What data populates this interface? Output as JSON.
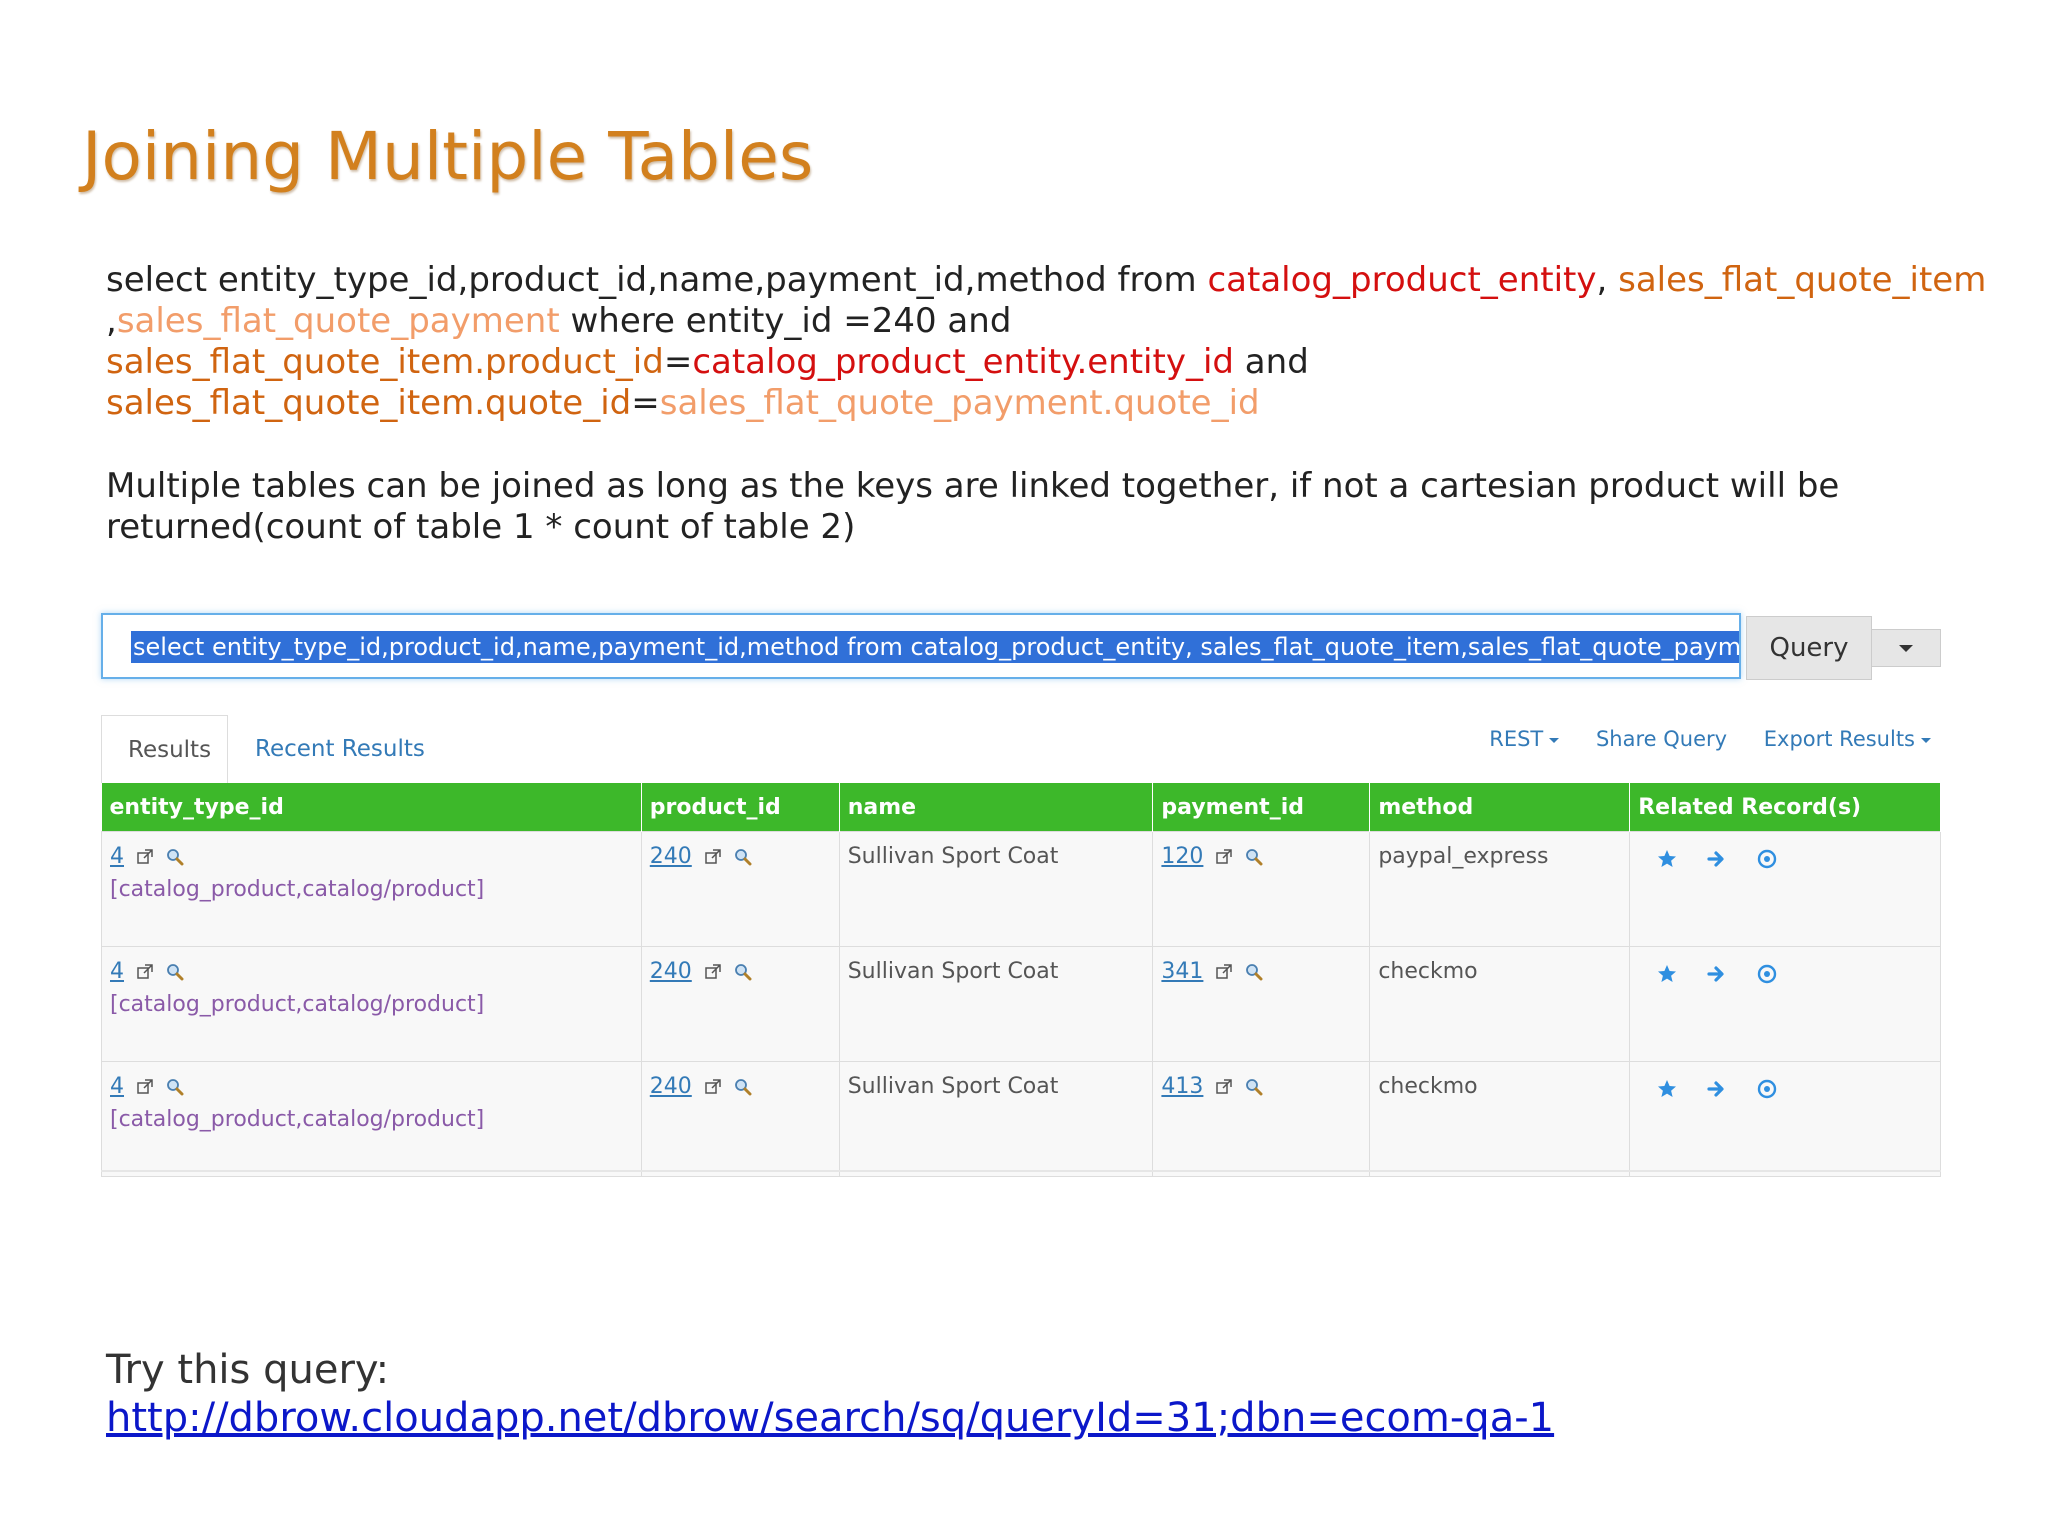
{
  "title": "Joining Multiple Tables",
  "sql": {
    "p1": "select entity_type_id,product_id,name,payment_id,method from ",
    "t1": "catalog_product_entity",
    "p2": ", ",
    "t2": "sales_flat_quote_item",
    "p3": ",",
    "t3": "sales_flat_quote_payment",
    "p4": "  where entity_id =240 and",
    "j1a": "sales_flat_quote_item.product_id",
    "eq1": "=",
    "j1b": "catalog_product_entity.entity_id",
    "and1": " and",
    "j2a": "sales_flat_quote_item.quote_id",
    "eq2": "=",
    "j2b": "sales_flat_quote_payment.quote_id"
  },
  "explain": "Multiple tables can be joined as long as the keys are linked together, if not a cartesian product will be returned(count of table 1 * count of table 2)",
  "query_bar": {
    "input_value": "select entity_type_id,product_id,name,payment_id,method from catalog_product_entity, sales_flat_quote_item,sales_flat_quote_payment  whe",
    "button_label": "Query"
  },
  "tabs": {
    "results": "Results",
    "recent": "Recent Results"
  },
  "actions": {
    "rest": "REST",
    "share": "Share Query",
    "export": "Export Results"
  },
  "table": {
    "headers": [
      "entity_type_id",
      "product_id",
      "name",
      "payment_id",
      "method",
      "Related Record(s)"
    ],
    "rows": [
      {
        "entity_type_id": "4",
        "entity_sub": "[catalog_product,catalog/product]",
        "product_id": "240",
        "name": "Sullivan Sport Coat",
        "payment_id": "120",
        "method": "paypal_express"
      },
      {
        "entity_type_id": "4",
        "entity_sub": "[catalog_product,catalog/product]",
        "product_id": "240",
        "name": "Sullivan Sport Coat",
        "payment_id": "341",
        "method": "checkmo"
      },
      {
        "entity_type_id": "4",
        "entity_sub": "[catalog_product,catalog/product]",
        "product_id": "240",
        "name": "Sullivan Sport Coat",
        "payment_id": "413",
        "method": "checkmo"
      }
    ]
  },
  "try": {
    "label": "Try this query:",
    "url": "http://dbrow.cloudapp.net/dbrow/search/sq/queryId=31;dbn=ecom-qa-1"
  },
  "colors": {
    "title": "#d2801e",
    "table_header": "#3db82a",
    "link": "#337ab7",
    "red": "#d40f0f",
    "orange": "#d06410",
    "peach": "#f29d6a"
  },
  "icons": [
    "external-link-icon",
    "magnifier-icon",
    "star-icon",
    "arrow-right-icon",
    "target-icon"
  ]
}
